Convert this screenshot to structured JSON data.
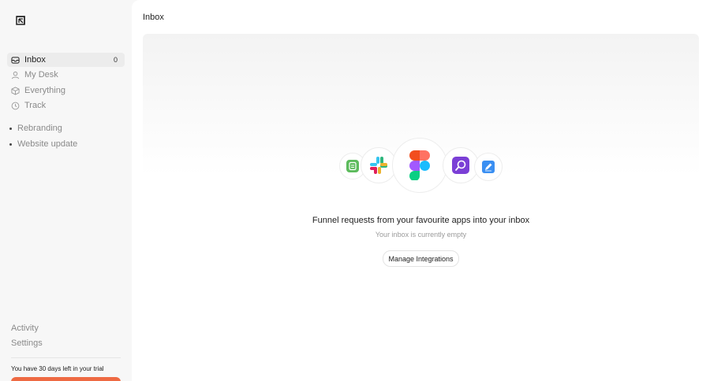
{
  "sidebar": {
    "nav": [
      {
        "label": "Inbox",
        "count": "0",
        "icon": "inbox-icon"
      },
      {
        "label": "My Desk",
        "icon": "user-icon"
      },
      {
        "label": "Everything",
        "icon": "box-icon"
      },
      {
        "label": "Track",
        "icon": "clock-icon"
      }
    ],
    "projects": [
      {
        "label": "Rebranding"
      },
      {
        "label": "Website update"
      }
    ],
    "bottom": [
      {
        "label": "Activity"
      },
      {
        "label": "Settings"
      }
    ],
    "trial_text": "You have 30 days left in your trial"
  },
  "main": {
    "title": "Inbox",
    "empty_title": "Funnel requests from your favourite apps into your inbox",
    "empty_subtitle": "Your inbox is currently empty",
    "manage_button": "Manage Integrations",
    "integration_icons": [
      "green-app-icon",
      "slack-icon",
      "figma-icon",
      "purple-app-icon",
      "blue-pencil-app-icon"
    ]
  },
  "colors": {
    "accent": "#ee6a43",
    "active_nav_bg": "#ececec"
  }
}
